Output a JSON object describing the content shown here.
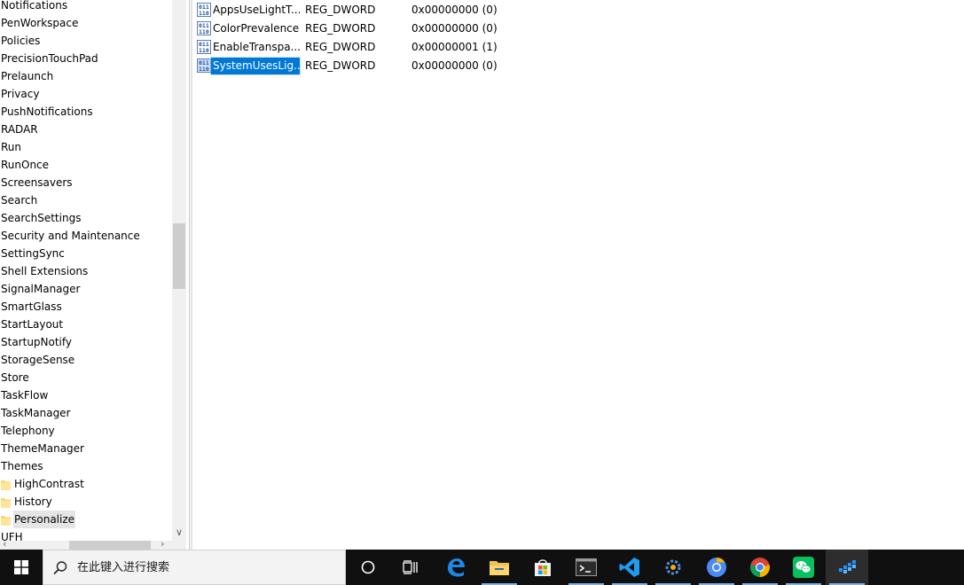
{
  "tree": {
    "items": [
      {
        "label": "Notifications",
        "folder": false
      },
      {
        "label": "PenWorkspace",
        "folder": false
      },
      {
        "label": "Policies",
        "folder": false
      },
      {
        "label": "PrecisionTouchPad",
        "folder": false
      },
      {
        "label": "Prelaunch",
        "folder": false
      },
      {
        "label": "Privacy",
        "folder": false
      },
      {
        "label": "PushNotifications",
        "folder": false
      },
      {
        "label": "RADAR",
        "folder": false
      },
      {
        "label": "Run",
        "folder": false
      },
      {
        "label": "RunOnce",
        "folder": false
      },
      {
        "label": "Screensavers",
        "folder": false
      },
      {
        "label": "Search",
        "folder": false
      },
      {
        "label": "SearchSettings",
        "folder": false
      },
      {
        "label": "Security and Maintenance",
        "folder": false
      },
      {
        "label": "SettingSync",
        "folder": false
      },
      {
        "label": "Shell Extensions",
        "folder": false
      },
      {
        "label": "SignalManager",
        "folder": false
      },
      {
        "label": "SmartGlass",
        "folder": false
      },
      {
        "label": "StartLayout",
        "folder": false
      },
      {
        "label": "StartupNotify",
        "folder": false
      },
      {
        "label": "StorageSense",
        "folder": false
      },
      {
        "label": "Store",
        "folder": false
      },
      {
        "label": "TaskFlow",
        "folder": false
      },
      {
        "label": "TaskManager",
        "folder": false
      },
      {
        "label": "Telephony",
        "folder": false
      },
      {
        "label": "ThemeManager",
        "folder": false
      },
      {
        "label": "Themes",
        "folder": false
      },
      {
        "label": "HighContrast",
        "folder": true
      },
      {
        "label": "History",
        "folder": true
      },
      {
        "label": "Personalize",
        "folder": true,
        "selected": true
      },
      {
        "label": "UFH",
        "folder": false
      }
    ]
  },
  "values": {
    "rows": [
      {
        "name": "AppsUseLightT...",
        "type": "REG_DWORD",
        "data": "0x00000000 (0)"
      },
      {
        "name": "ColorPrevalence",
        "type": "REG_DWORD",
        "data": "0x00000000 (0)"
      },
      {
        "name": "EnableTranspa...",
        "type": "REG_DWORD",
        "data": "0x00000001 (1)"
      },
      {
        "name": "SystemUsesLig...",
        "type": "REG_DWORD",
        "data": "0x00000000 (0)",
        "selected": true
      }
    ]
  },
  "taskbar": {
    "search_placeholder": "在此键入进行搜索",
    "apps": [
      "cortana",
      "task-view",
      "edge",
      "file-explorer",
      "store",
      "terminal",
      "vscode",
      "settings-tool",
      "chrome-alt",
      "chrome",
      "wechat",
      "regedit"
    ]
  },
  "colors": {
    "selection": "#0078d7",
    "taskbar": "#101010",
    "folder": "#f8d775"
  }
}
